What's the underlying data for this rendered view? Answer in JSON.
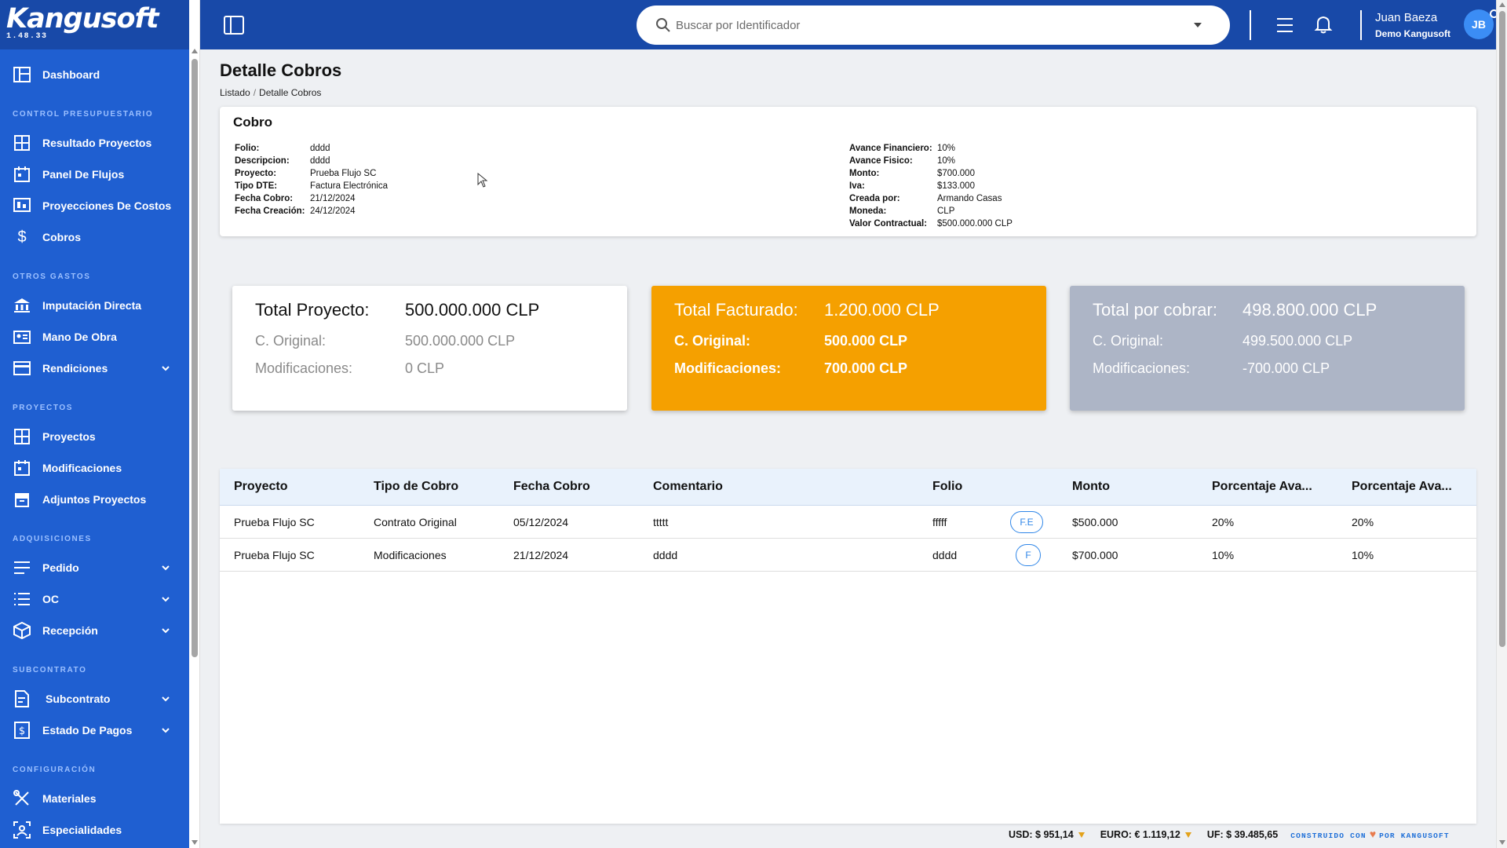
{
  "app": {
    "brand": "Kangusoft",
    "version": "1.48.33"
  },
  "sidebar": {
    "items": {
      "dashboard": "Dashboard",
      "resultado_proyectos": "Resultado Proyectos",
      "panel_flujos": "Panel De Flujos",
      "proyecciones_costos": "Proyecciones De Costos",
      "cobros": "Cobros",
      "imputacion_directa": "Imputación Directa",
      "mano_obra": "Mano De Obra",
      "rendiciones": "Rendiciones",
      "proyectos": "Proyectos",
      "modificaciones": "Modificaciones",
      "adjuntos_proyectos": "Adjuntos Proyectos",
      "pedido": "Pedido",
      "oc": "OC",
      "recepcion": "Recepción",
      "subcontrato": "Subcontrato",
      "estado_pagos": "Estado De Pagos",
      "materiales": "Materiales",
      "especialidades": "Especialidades"
    },
    "sections": {
      "control": "CONTROL PRESUPUESTARIO",
      "otros": "OTROS GASTOS",
      "proyectos": "PROYECTOS",
      "adquisiciones": "ADQUISICIONES",
      "subcontrato": "SUBCONTRATO",
      "configuracion": "CONFIGURACIÓN"
    }
  },
  "topbar": {
    "search_placeholder": "Buscar por Identificador",
    "user_name": "Juan Baeza",
    "user_org": "Demo Kangusoft",
    "avatar_initials": "JB"
  },
  "page": {
    "title": "Detalle Cobros",
    "breadcrumb": [
      "Listado",
      "Detalle Cobros"
    ]
  },
  "cobro": {
    "title": "Cobro",
    "left": [
      {
        "k": "Folio:",
        "v": "dddd"
      },
      {
        "k": "Descripcion:",
        "v": "dddd"
      },
      {
        "k": "Proyecto:",
        "v": "Prueba Flujo SC"
      },
      {
        "k": "Tipo DTE:",
        "v": "Factura Electrónica"
      },
      {
        "k": "Fecha Cobro:",
        "v": "21/12/2024"
      },
      {
        "k": "Fecha Creación:",
        "v": "24/12/2024"
      }
    ],
    "right": [
      {
        "k": "Avance Financiero:",
        "v": "10%"
      },
      {
        "k": "Avance Fisico:",
        "v": "10%"
      },
      {
        "k": "Monto:",
        "v": "$700.000"
      },
      {
        "k": "Iva:",
        "v": "$133.000"
      },
      {
        "k": "Creada por:",
        "v": "Armando Casas"
      },
      {
        "k": "Moneda:",
        "v": "CLP"
      },
      {
        "k": "Valor Contractual:",
        "v": "$500.000.000 CLP"
      }
    ]
  },
  "stats": [
    {
      "title": "Total Proyecto:",
      "total": "500.000.000 CLP",
      "orig_label": "C. Original:",
      "orig": "500.000.000 CLP",
      "mod_label": "Modificaciones:",
      "mod": "0 CLP",
      "bg": "#ffffff"
    },
    {
      "title": "Total Facturado:",
      "total": "1.200.000 CLP",
      "orig_label": "C. Original:",
      "orig": "500.000 CLP",
      "mod_label": "Modificaciones:",
      "mod": "700.000 CLP",
      "bg": "#f5a000"
    },
    {
      "title": "Total por cobrar:",
      "total": "498.800.000 CLP",
      "orig_label": "C. Original:",
      "orig": "499.500.000 CLP",
      "mod_label": "Modificaciones:",
      "mod": "-700.000 CLP",
      "bg": "#adb5c6"
    }
  ],
  "table": {
    "headers": [
      "Proyecto",
      "Tipo de Cobro",
      "Fecha Cobro",
      "Comentario",
      "Folio",
      "Monto",
      "Porcentaje Ava...",
      "Porcentaje Ava..."
    ],
    "rows": [
      {
        "proyecto": "Prueba Flujo SC",
        "tipo": "Contrato Original",
        "fecha": "05/12/2024",
        "comentario": "ttttt",
        "folio": "fffff",
        "badge": "F.E",
        "monto": "$500.000",
        "pct1": "20%",
        "pct2": "20%"
      },
      {
        "proyecto": "Prueba Flujo SC",
        "tipo": "Modificaciones",
        "fecha": "21/12/2024",
        "comentario": "dddd",
        "folio": "dddd",
        "badge": "F",
        "monto": "$700.000",
        "pct1": "10%",
        "pct2": "10%"
      }
    ]
  },
  "footer": {
    "usd": "USD: $ 951,14",
    "euro": "EURO: € 1.119,12",
    "uf": "UF: $ 39.485,65",
    "built_prefix": "CONSTRUIDO CON",
    "built_suffix": "POR KANGUSOFT"
  },
  "colors": {
    "sidebar": "#1f5fd1",
    "topbar": "#1849a8",
    "accent_orange": "#f5a000",
    "accent_gray": "#adb5c6",
    "link_blue": "#2f86e8"
  }
}
